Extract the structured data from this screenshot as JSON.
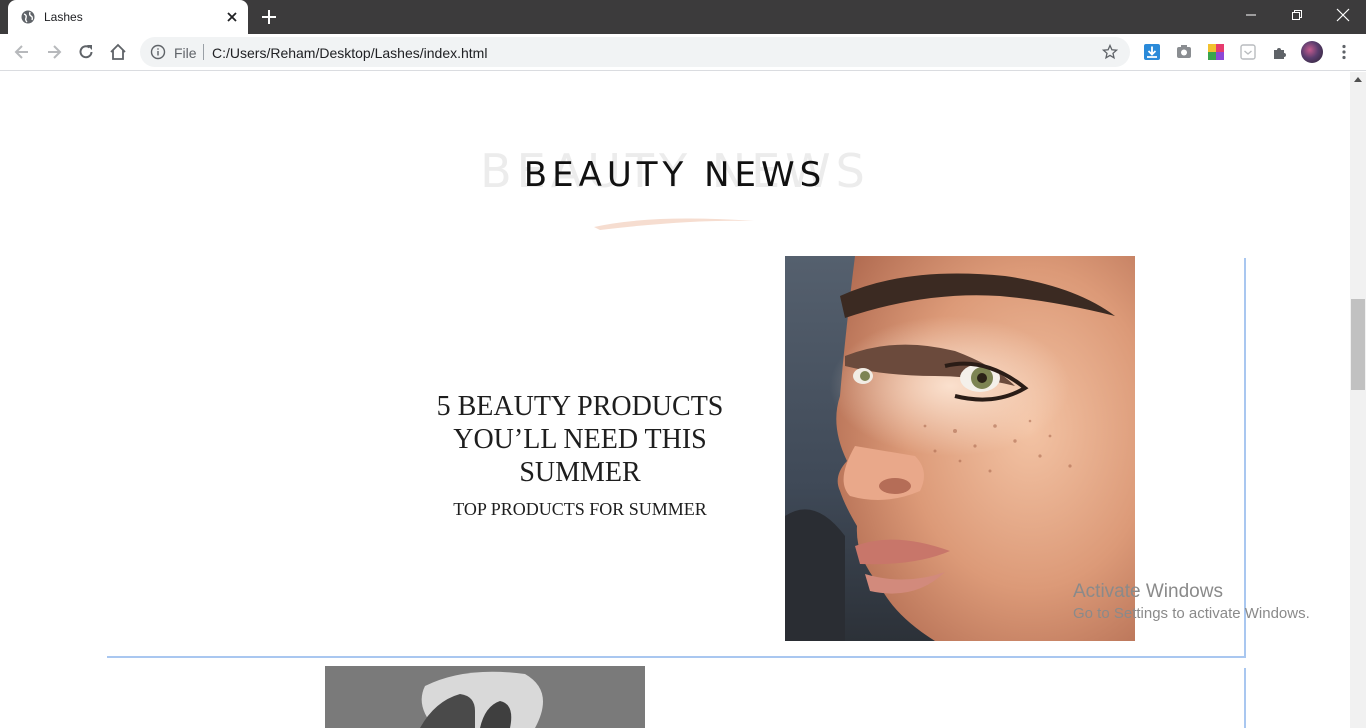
{
  "browser": {
    "tab_title": "Lashes",
    "omnibox_scheme_label": "File",
    "omnibox_url": "C:/Users/Reham/Desktop/Lashes/index.html"
  },
  "section": {
    "bg_heading": "BEAUTY NEWS",
    "heading": "BEAUTY NEWS"
  },
  "article": {
    "title": "5 BEAUTY PRODUCTS YOU’LL NEED THIS SUMMER",
    "subtitle": "TOP PRODUCTS FOR SUMMER"
  },
  "watermark": {
    "title": "Activate Windows",
    "subtitle": "Go to Settings to activate Windows."
  },
  "colors": {
    "titlebar": "#3c3b3c",
    "card_border": "#a9c7f0",
    "brush": "#f6ddd0"
  },
  "icons": {
    "back": "arrow-left-icon",
    "forward": "arrow-right-icon",
    "reload": "reload-icon",
    "home": "home-icon",
    "info": "info-icon",
    "star": "star-icon",
    "extensions": "puzzle-icon",
    "menu": "kebab-menu-icon"
  }
}
